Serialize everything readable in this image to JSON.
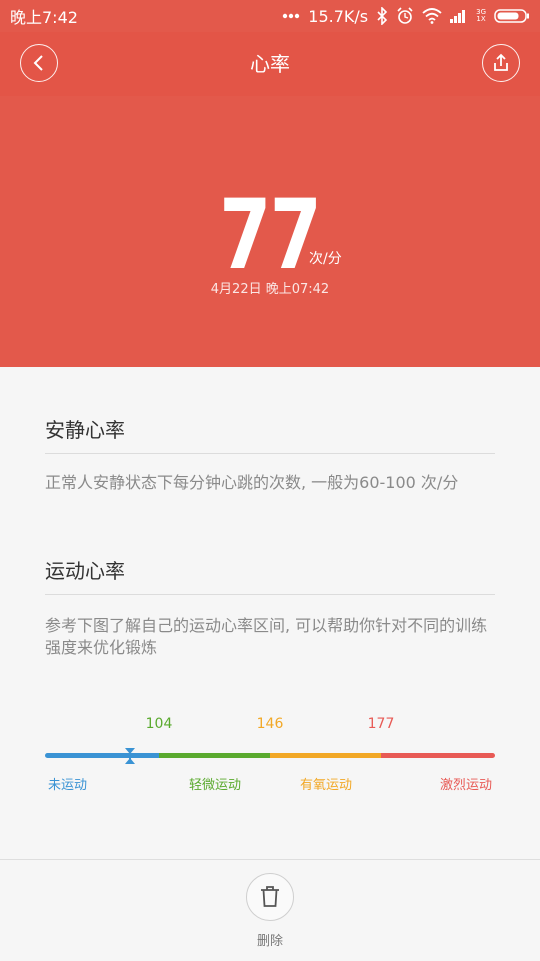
{
  "status_bar": {
    "time": "晚上7:42",
    "net_speed": "15.7K/s",
    "network_type": "3G",
    "sim_label": "1X"
  },
  "header": {
    "title": "心率",
    "color": "#e3594b"
  },
  "reading": {
    "value": "77",
    "unit": "次/分",
    "timestamp": "4月22日 晚上07:42"
  },
  "resting": {
    "title": "安静心率",
    "description": "正常人安静状态下每分钟心跳的次数, 一般为60-100 次/分"
  },
  "exercise": {
    "title": "运动心率",
    "description": "参考下图了解自己的运动心率区间, 可以帮助你针对不同的训练强度来优化锻炼"
  },
  "zones": {
    "thresholds": [
      "104",
      "146",
      "177"
    ],
    "labels": [
      "未运动",
      "轻微运动",
      "有氧运动",
      "激烈运动"
    ],
    "colors": [
      "#3a93d4",
      "#5aaa2e",
      "#f2a826",
      "#e85a55"
    ],
    "marker_value": 77
  },
  "footer": {
    "delete_label": "删除"
  }
}
